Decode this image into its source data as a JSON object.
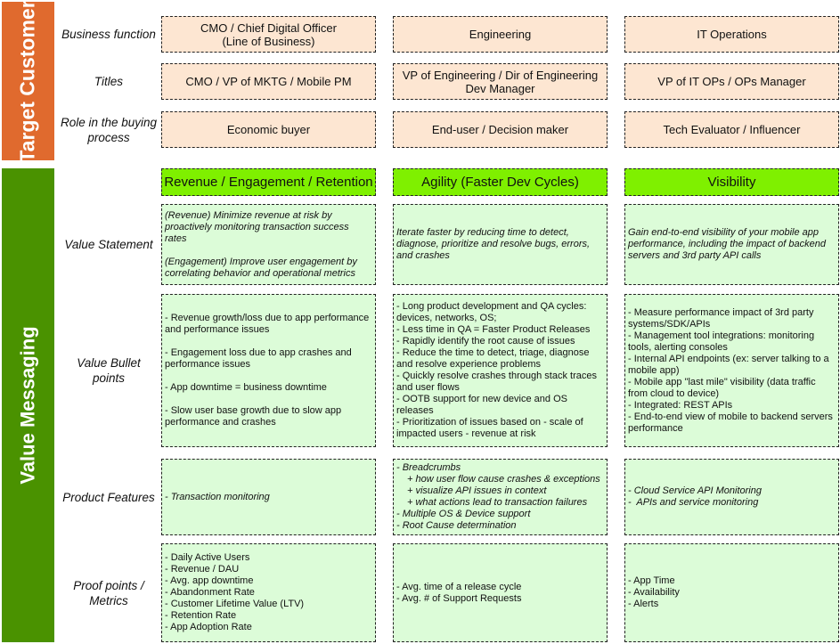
{
  "sections": {
    "target_customer": "Target Customer",
    "value_messaging": "Value Messaging"
  },
  "row_labels": {
    "business_function": "Business function",
    "titles": "Titles",
    "role": "Role in the buying process",
    "value_statement": "Value Statement",
    "value_bullets": "Value Bullet points",
    "product_features": "Product Features",
    "proof_points": "Proof points / Metrics"
  },
  "columns": [
    {
      "business_function": [
        "CMO / Chief Digital Officer",
        "(Line of Business)"
      ],
      "title": [
        "CMO / VP of MKTG / Mobile PM"
      ],
      "role": "Economic buyer",
      "theme": "Revenue / Engagement / Retention",
      "value_statement": [
        "(Revenue) Minimize revenue at risk by proactively monitoring transaction success rates",
        "(Engagement) Improve user engagement by correlating behavior and operational metrics"
      ],
      "bullets": [
        "- Revenue growth/loss due to app performance and performance issues",
        "- Engagement loss due to app crashes and performance issues",
        "- App downtime = business downtime",
        "- Slow user base growth due to slow app performance and crashes"
      ],
      "features": [
        "- Transaction monitoring"
      ],
      "proof": [
        "- Daily Active Users",
        "- Revenue / DAU",
        "- Avg. app downtime",
        "- Abandonment Rate",
        "- Customer Lifetime Value (LTV)",
        "- Retention Rate",
        "- App Adoption Rate"
      ]
    },
    {
      "business_function": [
        "Engineering"
      ],
      "title": [
        "VP of Engineering / Dir of Engineering",
        "Dev Manager"
      ],
      "role": "End-user / Decision maker",
      "theme": "Agility (Faster Dev Cycles)",
      "value_statement": [
        "Iterate faster by reducing time to detect, diagnose, prioritize and resolve bugs, errors, and crashes"
      ],
      "bullets": [
        "- Long product development and QA cycles: devices, networks, OS;",
        "- Less time in QA = Faster Product Releases",
        "- Rapidly identify the root cause of issues",
        "- Reduce the time to detect, triage, diagnose and resolve experience problems",
        "- Quickly resolve crashes through stack traces and user flows",
        "- OOTB support for new device and OS releases",
        "- Prioritization of issues based on - scale of impacted users - revenue at risk"
      ],
      "features": [
        "- Breadcrumbs",
        "+ how user flow cause crashes & exceptions",
        "+ visualize API issues in context",
        "+ what actions lead to transaction failures",
        "- Multiple OS & Device support",
        "- Root Cause determination"
      ],
      "proof": [
        "- Avg. time of a release cycle",
        "- Avg. # of Support Requests"
      ]
    },
    {
      "business_function": [
        "IT Operations"
      ],
      "title": [
        "VP of IT OPs / OPs Manager"
      ],
      "role": "Tech Evaluator / Influencer",
      "theme": "Visibility",
      "value_statement": [
        "Gain end-to-end visibility of your mobile app performance, including the impact of backend servers and 3rd party API calls"
      ],
      "bullets": [
        "- Measure performance impact of 3rd party systems/SDK/APIs",
        "- Management tool integrations: monitoring tools, alerting consoles",
        "- Internal API endpoints (ex: server talking to a mobile app)",
        "- Mobile app \"last mile\" visibility (data traffic from cloud to device)",
        "- Integrated: REST APIs",
        "- End-to-end view of mobile to backend servers performance"
      ],
      "features": [
        "- Cloud Service API Monitoring",
        "-  APIs and service monitoring"
      ],
      "proof": [
        "- App Time",
        "- Availability",
        "- Alerts"
      ]
    }
  ],
  "colors": {
    "target_band": "#e06a2e",
    "value_band": "#4a9200",
    "customer_box": "#fde6d2",
    "theme_box": "#7ff000",
    "content_box": "#dcfcd8"
  }
}
